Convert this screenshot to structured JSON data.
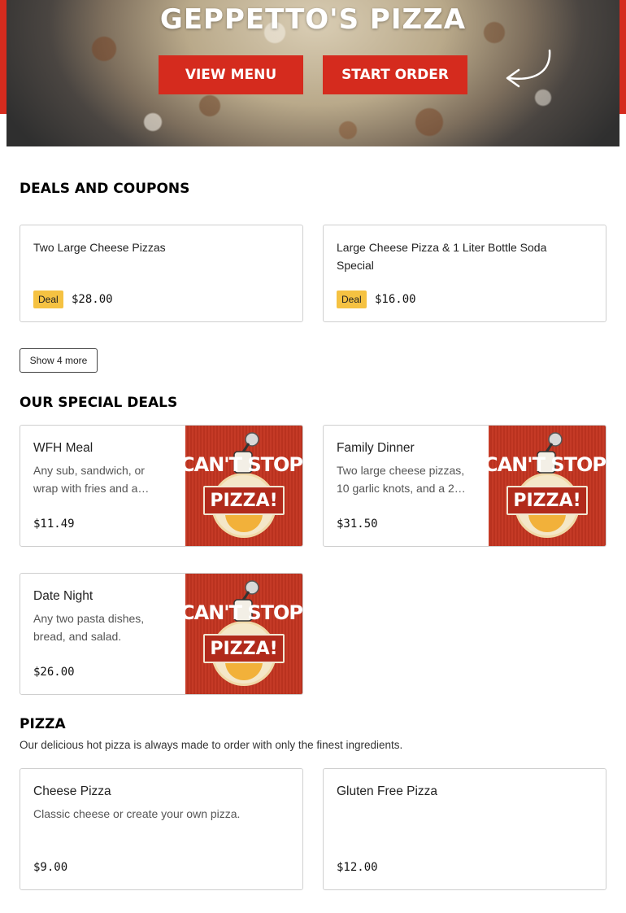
{
  "hero": {
    "title": "GEPPETTO'S PIZZA",
    "view_menu_label": "VIEW MENU",
    "start_order_label": "START ORDER"
  },
  "deals_section": {
    "title": "DEALS AND COUPONS",
    "deals": [
      {
        "name": "Two Large Cheese Pizzas",
        "badge": "Deal",
        "price": "$28.00"
      },
      {
        "name": "Large Cheese Pizza & 1 Liter Bottle Soda Special",
        "badge": "Deal",
        "price": "$16.00"
      }
    ],
    "show_more_label": "Show 4 more"
  },
  "special_section": {
    "title": "OUR SPECIAL DEALS",
    "promo_image_text": "CAN'T STOP PIZZA!",
    "items": [
      {
        "name": "WFH Meal",
        "description": "Any sub, sandwich, or wrap with fries and a…",
        "price": "$11.49"
      },
      {
        "name": "Family Dinner",
        "description": "Two large cheese pizzas, 10 garlic knots, and a 2…",
        "price": "$31.50"
      },
      {
        "name": "Date Night",
        "description": "Any two pasta dishes, bread, and salad.",
        "price": "$26.00"
      }
    ]
  },
  "pizza_section": {
    "title": "PIZZA",
    "description": "Our delicious hot pizza is always made to order with only the finest ingredients.",
    "items": [
      {
        "name": "Cheese Pizza",
        "description": "Classic cheese or create your own pizza.",
        "price": "$9.00"
      },
      {
        "name": "Gluten Free Pizza",
        "description": "",
        "price": "$12.00"
      }
    ]
  },
  "colors": {
    "brand_red": "#d52b1e",
    "deal_badge": "#f5c242"
  }
}
